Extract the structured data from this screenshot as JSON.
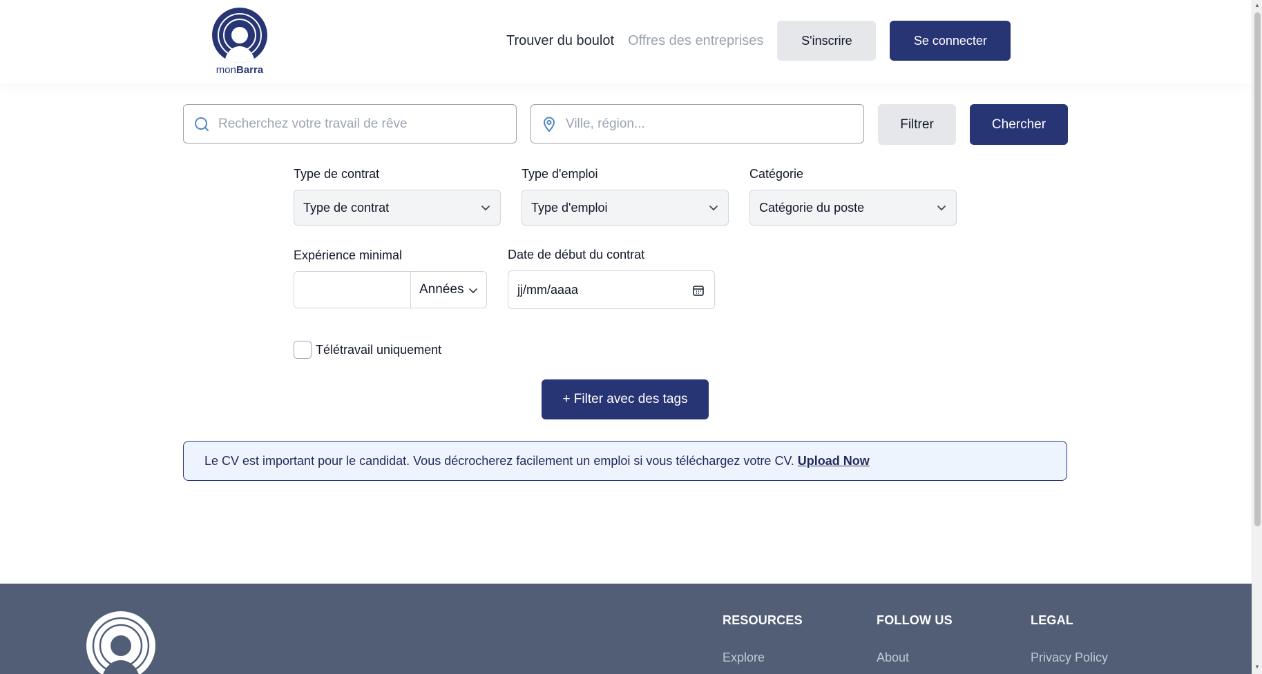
{
  "brand": {
    "prefix": "mon",
    "name": "Barra"
  },
  "nav": {
    "find_jobs": "Trouver du boulot",
    "company_offers": "Offres des entreprises",
    "signup": "S'inscrire",
    "login": "Se connecter"
  },
  "search": {
    "job_placeholder": "Recherchez votre travail de rêve",
    "location_placeholder": "Ville, région...",
    "filter_label": "Filtrer",
    "search_label": "Chercher"
  },
  "filters": {
    "contract_type": {
      "label": "Type de contrat",
      "value": "Type de contrat"
    },
    "job_type": {
      "label": "Type d'emploi",
      "value": "Type d'emploi"
    },
    "category": {
      "label": "Catégorie",
      "value": "Catégorie du poste"
    },
    "experience": {
      "label": "Expérience minimal",
      "value": "",
      "unit": "Années"
    },
    "start_date": {
      "label": "Date de début du contrat",
      "value": "jj/mm/aaaa"
    },
    "remote": {
      "label": "Télétravail uniquement",
      "checked": false
    },
    "tags_button": "+ Filter avec des tags"
  },
  "cv_banner": {
    "text": "Le CV est important pour le candidat. Vous décrocherez facilement un emploi si vous téléchargez votre CV.",
    "link": "Upload Now"
  },
  "footer": {
    "columns": [
      {
        "title": "RESOURCES",
        "link": "Explore"
      },
      {
        "title": "FOLLOW US",
        "link": "About"
      },
      {
        "title": "LEGAL",
        "link": "Privacy Policy"
      }
    ]
  },
  "colors": {
    "primary": "#283575",
    "light_button": "#e5e7eb",
    "footer_bg": "#515e76",
    "banner_bg": "#eef4fd",
    "icon_blue": "#4f86c6"
  }
}
